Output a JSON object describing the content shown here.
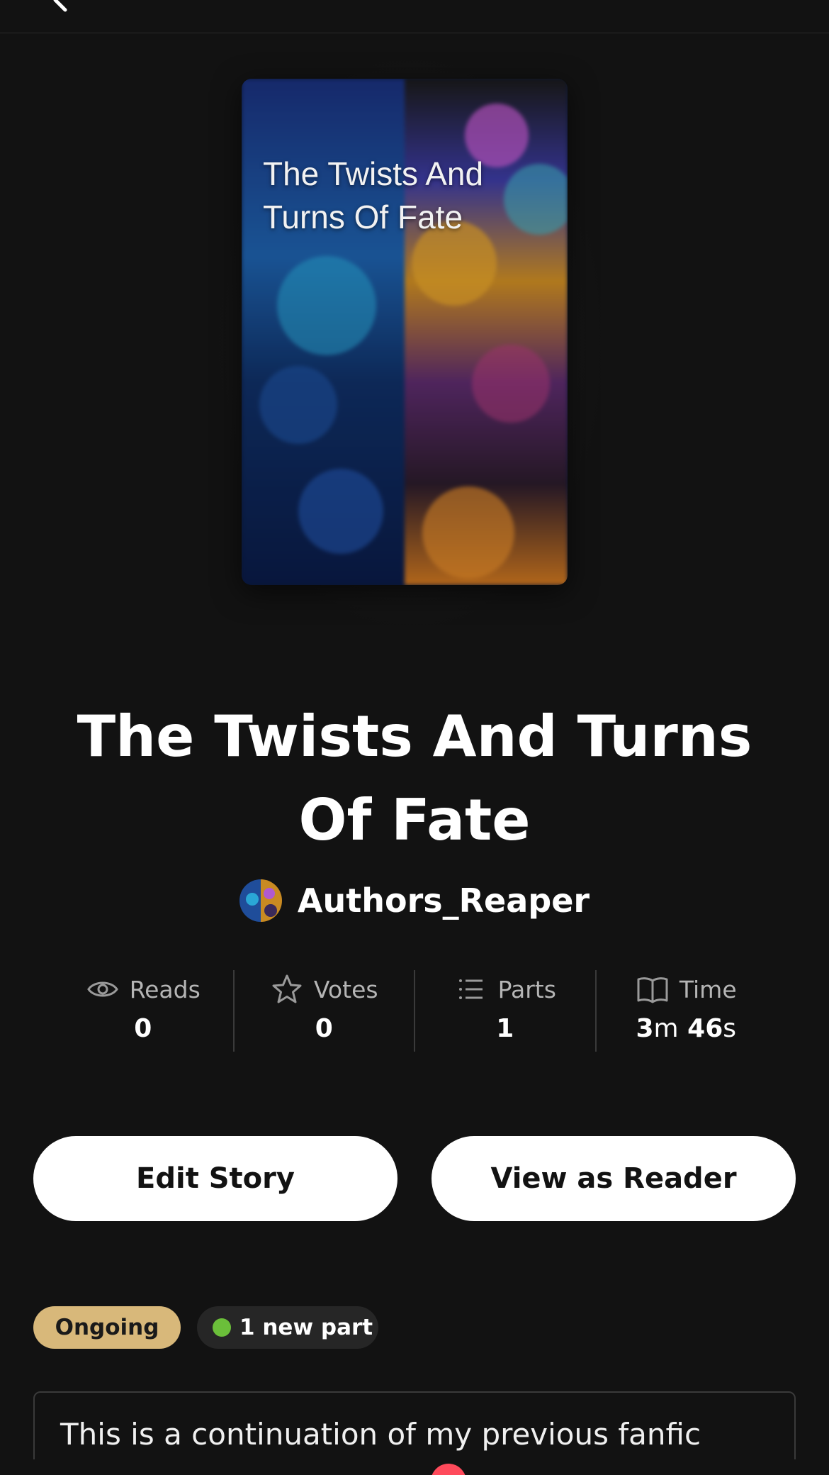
{
  "header": {
    "back_icon": "chevron-left-icon"
  },
  "cover": {
    "title": "The Twists And Turns Of Fate"
  },
  "story": {
    "title": "The Twists And Turns Of Fate",
    "author": "Authors_Reaper"
  },
  "stats": [
    {
      "icon": "eye-icon",
      "label": "Reads",
      "value": "0"
    },
    {
      "icon": "star-icon",
      "label": "Votes",
      "value": "0"
    },
    {
      "icon": "list-icon",
      "label": "Parts",
      "value": "1"
    },
    {
      "icon": "book-icon",
      "label": "Time",
      "minutes": "3",
      "minutes_unit": "m",
      "seconds": "46",
      "seconds_unit": "s"
    }
  ],
  "actions": {
    "edit_label": "Edit Story",
    "view_label": "View as Reader"
  },
  "badges": {
    "status": "Ongoing",
    "new_parts": "1 new part"
  },
  "description": {
    "text": "This is a continuation of my previous fanfic"
  },
  "colors": {
    "background": "#121212",
    "status_badge": "#d8b87a",
    "new_dot": "#6bbf3a",
    "notification": "#ff4a5b"
  }
}
